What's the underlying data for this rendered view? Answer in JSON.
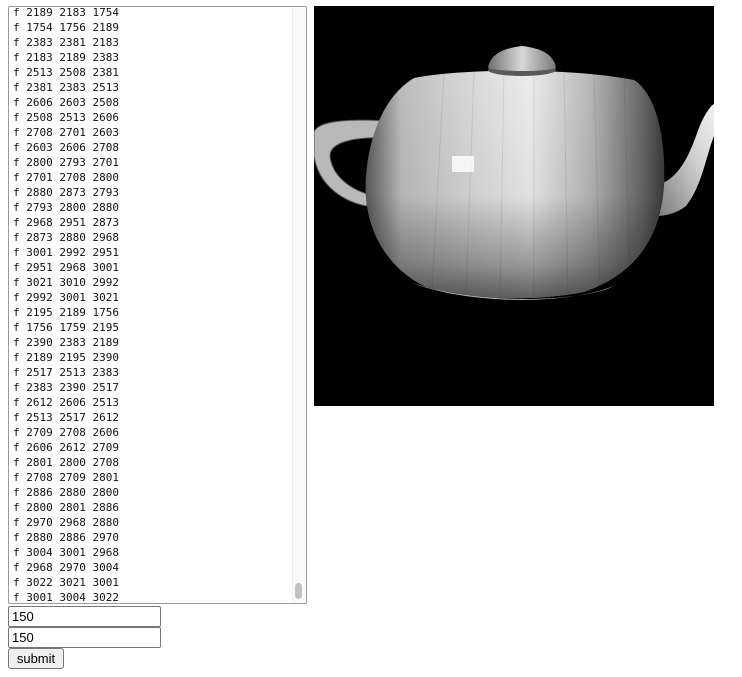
{
  "obj_text": {
    "lines": [
      "f 2189 2183 1754",
      "f 1754 1756 2189",
      "f 2383 2381 2183",
      "f 2183 2189 2383",
      "f 2513 2508 2381",
      "f 2381 2383 2513",
      "f 2606 2603 2508",
      "f 2508 2513 2606",
      "f 2708 2701 2603",
      "f 2603 2606 2708",
      "f 2800 2793 2701",
      "f 2701 2708 2800",
      "f 2880 2873 2793",
      "f 2793 2800 2880",
      "f 2968 2951 2873",
      "f 2873 2880 2968",
      "f 3001 2992 2951",
      "f 2951 2968 3001",
      "f 3021 3010 2992",
      "f 2992 3001 3021",
      "f 2195 2189 1756",
      "f 1756 1759 2195",
      "f 2390 2383 2189",
      "f 2189 2195 2390",
      "f 2517 2513 2383",
      "f 2383 2390 2517",
      "f 2612 2606 2513",
      "f 2513 2517 2612",
      "f 2709 2708 2606",
      "f 2606 2612 2709",
      "f 2801 2800 2708",
      "f 2708 2709 2801",
      "f 2886 2880 2800",
      "f 2800 2801 2886",
      "f 2970 2968 2880",
      "f 2880 2886 2970",
      "f 3004 3001 2968",
      "f 2968 2970 3004",
      "f 3022 3021 3001",
      "f 3001 3004 3022"
    ]
  },
  "width_input": {
    "value": "150"
  },
  "height_input": {
    "value": "150"
  },
  "submit_label": "submit",
  "colors": {
    "canvas_bg": "#000000"
  }
}
